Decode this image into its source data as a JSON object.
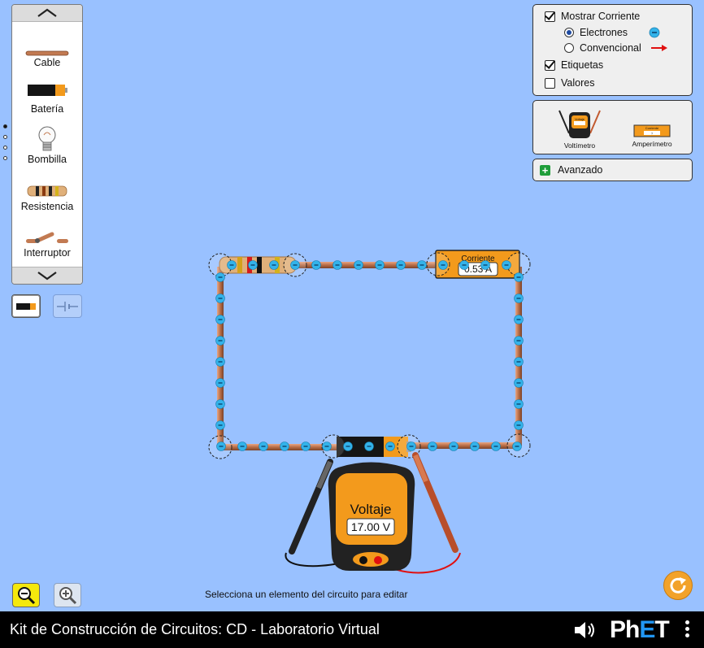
{
  "app_title": "Kit de Construcción de Circuitos: CD - Laboratorio Virtual",
  "carousel": {
    "items": [
      {
        "label": "Cable",
        "icon": "wire-icon"
      },
      {
        "label": "Batería",
        "icon": "battery-icon"
      },
      {
        "label": "Bombilla",
        "icon": "lightbulb-icon"
      },
      {
        "label": "Resistencia",
        "icon": "resistor-icon"
      },
      {
        "label": "Interruptor",
        "icon": "switch-icon"
      }
    ],
    "page_count": 4,
    "current_page": 1
  },
  "view_modes": [
    "lifelike-view-icon",
    "schematic-view-icon"
  ],
  "display_panel": {
    "show_current_label": "Mostrar Corriente",
    "show_current_checked": true,
    "electrons_label": "Electrones",
    "electrons_selected": true,
    "conventional_label": "Convencional",
    "conventional_selected": false,
    "labels_label": "Etiquetas",
    "labels_checked": true,
    "values_label": "Valores",
    "values_checked": false
  },
  "tools_panel": {
    "voltmeter_label": "Voltímetro",
    "ammeter_label": "Amperímetro",
    "voltmeter_screen_text": "Voltaje",
    "ammeter_screen_text": "Corriente",
    "ammeter_screen_value": "?"
  },
  "advanced_label": "Avanzado",
  "ammeter": {
    "title": "Corriente",
    "value": "0.53 A"
  },
  "voltmeter": {
    "title": "Voltaje",
    "value": "17.00 V"
  },
  "hint_text": "Selecciona un elemento del circuito para editar",
  "brand": {
    "p": "Ph",
    "e": "E",
    "t": "T"
  },
  "colors": {
    "background": "#99c1ff",
    "wire": "#c27a52",
    "electron": "#33b3ea",
    "meter_orange": "#f39a1c",
    "zoom_out": "#f5e80c",
    "reset": "#f2a22a"
  }
}
